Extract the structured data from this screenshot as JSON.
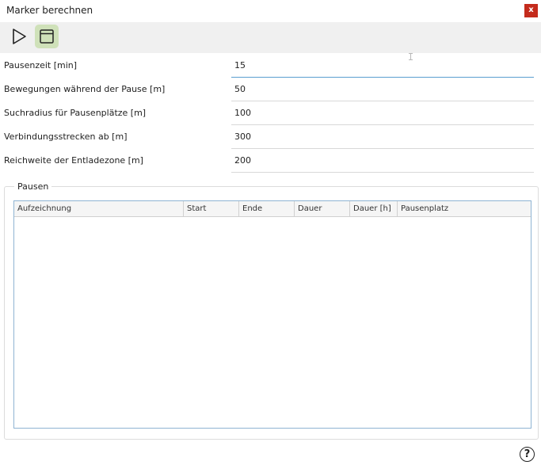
{
  "window": {
    "title": "Marker berechnen",
    "close_label": "x"
  },
  "toolbar": {
    "play_icon": "play-icon",
    "layout_icon": "window-layout-icon",
    "accent": "#cfe1b9"
  },
  "form": {
    "rows": [
      {
        "label": "Pausenzeit [min]",
        "value": "15"
      },
      {
        "label": "Bewegungen während der Pause [m]",
        "value": "50"
      },
      {
        "label": "Suchradius für Pausenplätze [m]",
        "value": "100"
      },
      {
        "label": "Verbindungsstrecken ab [m]",
        "value": "300"
      },
      {
        "label": "Reichweite der Entladezone [m]",
        "value": "200"
      }
    ]
  },
  "pausen": {
    "title": "Pausen",
    "columns": [
      "Aufzeichnung",
      "Start",
      "Ende",
      "Dauer",
      "Dauer [h]",
      "Pausenplatz"
    ]
  },
  "help": {
    "label": "?"
  }
}
